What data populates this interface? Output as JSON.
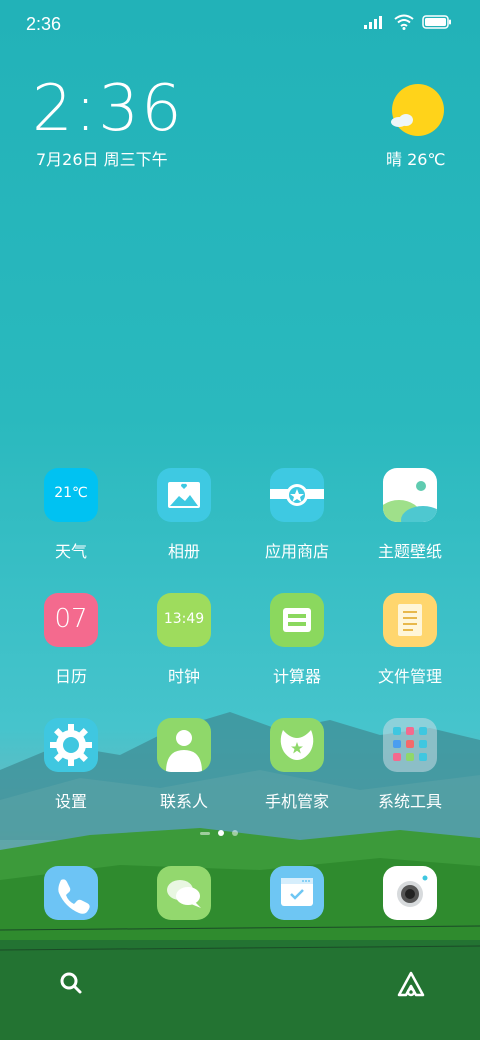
{
  "status_bar": {
    "time": "2:36",
    "icons": [
      "signal-icon",
      "wifi-icon",
      "battery-icon"
    ]
  },
  "clock_widget": {
    "time": "2:36",
    "date": "7月26日 周三下午"
  },
  "weather_widget": {
    "text": "晴 26℃",
    "icon": "sunny-icon"
  },
  "apps": {
    "weather": {
      "label": "天气",
      "icon_text": "21℃"
    },
    "gallery": {
      "label": "相册"
    },
    "app_store": {
      "label": "应用商店"
    },
    "themes": {
      "label": "主题壁纸"
    },
    "calendar": {
      "label": "日历",
      "icon_text": "07"
    },
    "clock": {
      "label": "时钟",
      "icon_text": "13:49"
    },
    "calculator": {
      "label": "计算器"
    },
    "file_manager": {
      "label": "文件管理"
    },
    "settings": {
      "label": "设置"
    },
    "contacts": {
      "label": "联系人"
    },
    "security": {
      "label": "手机管家"
    },
    "tools": {
      "label": "系统工具"
    }
  },
  "dock": [
    "phone-icon",
    "messages-icon",
    "browser-icon",
    "camera-icon"
  ],
  "page_indicator": {
    "pages": 3,
    "current": 2
  },
  "bottom_bar": [
    "search-icon",
    "assistant-icon"
  ],
  "colors": {
    "weather": "#00c2f2",
    "gallery": "#3ec9e2",
    "app_store": "#3ec9e2",
    "calendar": "#f46a8e",
    "clock": "#9edc5d",
    "calculator": "#8bd85e",
    "file_manager": "#ffd66e",
    "settings": "#3fc7e0",
    "contacts": "#8fd86a",
    "security": "#8fd86a",
    "phone": "#6dc4f5",
    "messages": "#93d86e",
    "browser": "#6ec6f3",
    "sun": "#ffd31a"
  }
}
